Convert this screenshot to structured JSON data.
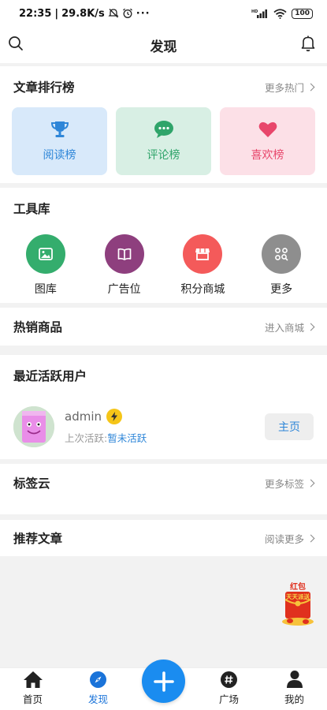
{
  "status_bar": {
    "time": "22:35",
    "network_speed": "29.8K/s",
    "battery": "100",
    "signal": "HD"
  },
  "header": {
    "title": "发现"
  },
  "article_rank": {
    "title": "文章排行榜",
    "more": "更多热门",
    "tiles": [
      {
        "label": "阅读榜",
        "icon": "trophy-icon"
      },
      {
        "label": "评论榜",
        "icon": "comment-icon"
      },
      {
        "label": "喜欢榜",
        "icon": "heart-icon"
      }
    ]
  },
  "tools": {
    "title": "工具库",
    "items": [
      {
        "label": "图库",
        "icon": "image-icon",
        "color": "#34ad6d"
      },
      {
        "label": "广告位",
        "icon": "book-icon",
        "color": "#8e3f7e"
      },
      {
        "label": "积分商城",
        "icon": "store-icon",
        "color": "#f45a5a"
      },
      {
        "label": "更多",
        "icon": "grid-search-icon",
        "color": "#8e8e8e"
      }
    ]
  },
  "hot_goods": {
    "title": "热销商品",
    "more": "进入商城"
  },
  "active_users": {
    "title": "最近活跃用户",
    "user": {
      "name": "admin",
      "last_label": "上次活跃:",
      "last_value": "暂未活跃",
      "button": "主页"
    }
  },
  "tag_cloud": {
    "title": "标签云",
    "more": "更多标签"
  },
  "recommend": {
    "title": "推荐文章",
    "more": "阅读更多"
  },
  "promo": {
    "line1": "红包",
    "line2": "天天派送"
  },
  "tabbar": {
    "items": [
      {
        "label": "首页",
        "icon": "home-icon"
      },
      {
        "label": "发现",
        "icon": "compass-icon"
      },
      {
        "label": "广场",
        "icon": "hashtag-icon"
      },
      {
        "label": "我的",
        "icon": "user-icon"
      }
    ],
    "active": "发现",
    "accent": "#1a73d9"
  }
}
